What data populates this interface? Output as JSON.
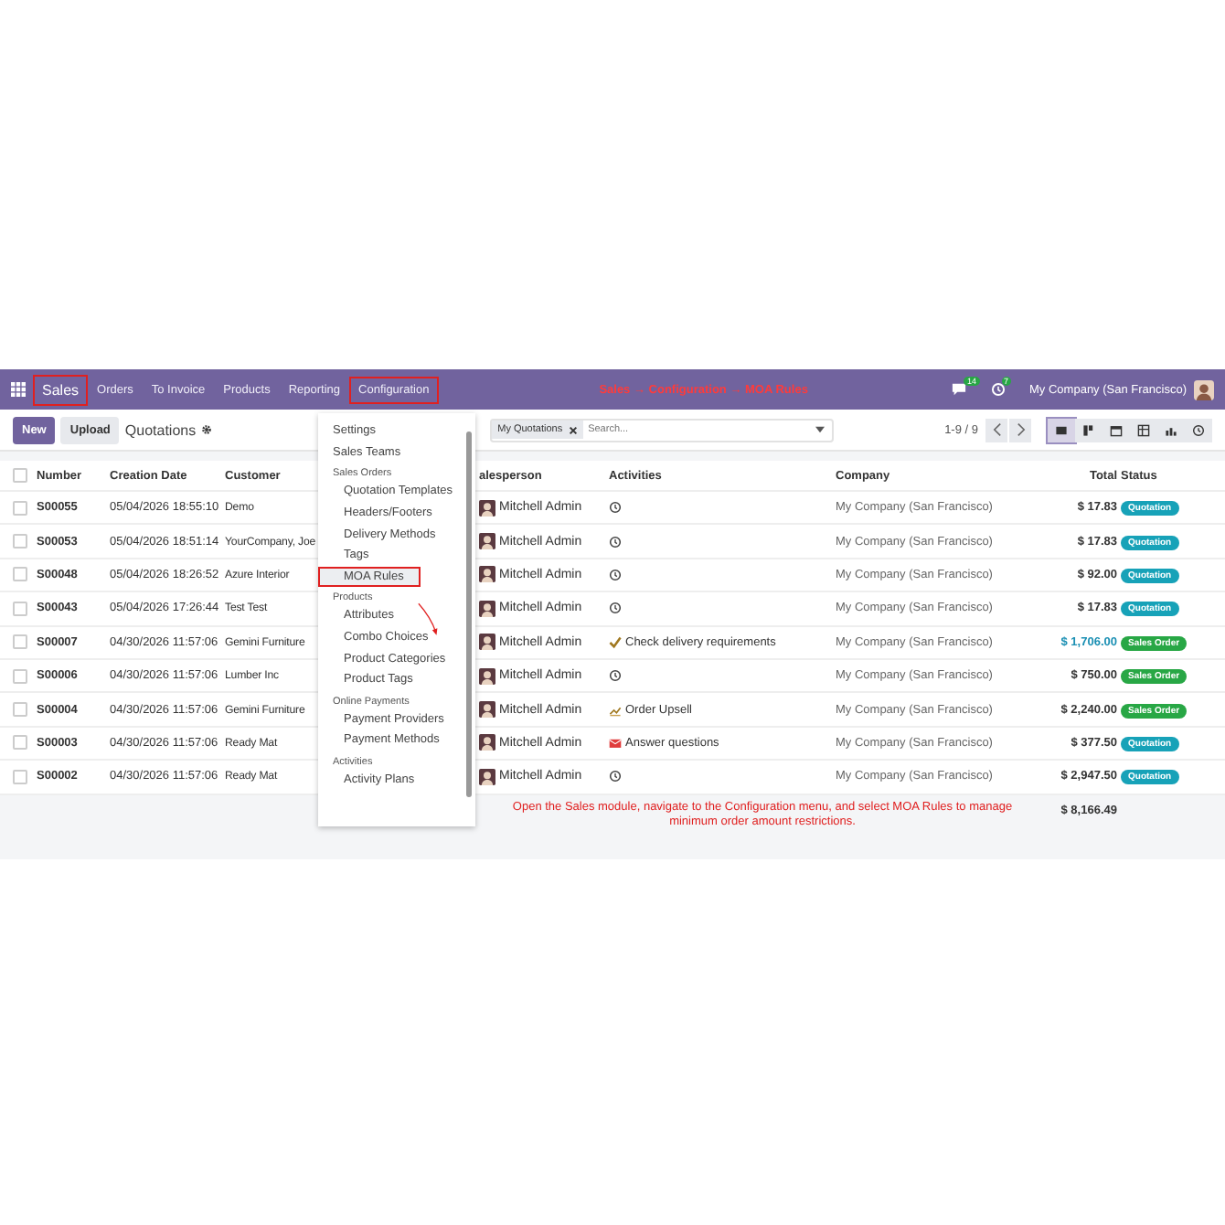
{
  "navbar": {
    "items": [
      {
        "label": "Sales",
        "highlighted": true,
        "kind": "brand"
      },
      {
        "label": "Orders",
        "highlighted": false,
        "kind": "menu"
      },
      {
        "label": "To Invoice",
        "highlighted": false,
        "kind": "menu"
      },
      {
        "label": "Products",
        "highlighted": false,
        "kind": "menu"
      },
      {
        "label": "Reporting",
        "highlighted": false,
        "kind": "menu"
      },
      {
        "label": "Configuration",
        "highlighted": true,
        "kind": "menu"
      }
    ],
    "caption": "Sales → Configuration → MOA Rules",
    "messages_badge": "14",
    "activities_badge": "7",
    "company": "My Company (San Francisco)"
  },
  "control_bar": {
    "new_button": "New",
    "upload_button": "Upload",
    "title": "Quotations",
    "search_facet": "My Quotations",
    "search_placeholder": "Search...",
    "pager": "1-9 / 9",
    "views": [
      {
        "kind": "list",
        "selected": true
      },
      {
        "kind": "kanban",
        "selected": false
      },
      {
        "kind": "calendar",
        "selected": false
      },
      {
        "kind": "pivot",
        "selected": false
      },
      {
        "kind": "graph",
        "selected": false
      },
      {
        "kind": "activity",
        "selected": false
      }
    ]
  },
  "table": {
    "select_all_checked": false,
    "columns": [
      "Number",
      "Creation Date",
      "Customer",
      "alesperson",
      "Activities",
      "Company",
      "Total",
      "Status"
    ],
    "rows": [
      {
        "checked": false,
        "number": "S00055",
        "date": "05/04/2026 18:55:10",
        "customer": "Demo",
        "salesperson": "Mitchell Admin",
        "activity": {
          "kind": "clock"
        },
        "company": "My Company (San Francisco)",
        "total": "$ 17.83",
        "total_highlight": false,
        "status": {
          "label": "Quotation",
          "color": "#17a2b8"
        }
      },
      {
        "checked": false,
        "number": "S00053",
        "date": "05/04/2026 18:51:14",
        "customer": "YourCompany, Joe",
        "salesperson": "Mitchell Admin",
        "activity": {
          "kind": "clock"
        },
        "company": "My Company (San Francisco)",
        "total": "$ 17.83",
        "total_highlight": false,
        "status": {
          "label": "Quotation",
          "color": "#17a2b8"
        }
      },
      {
        "checked": false,
        "number": "S00048",
        "date": "05/04/2026 18:26:52",
        "customer": "Azure Interior",
        "salesperson": "Mitchell Admin",
        "activity": {
          "kind": "clock"
        },
        "company": "My Company (San Francisco)",
        "total": "$ 92.00",
        "total_highlight": false,
        "status": {
          "label": "Quotation",
          "color": "#17a2b8"
        }
      },
      {
        "checked": false,
        "number": "S00043",
        "date": "05/04/2026 17:26:44",
        "customer": "Test Test",
        "salesperson": "Mitchell Admin",
        "activity": {
          "kind": "clock"
        },
        "company": "My Company (San Francisco)",
        "total": "$ 17.83",
        "total_highlight": false,
        "status": {
          "label": "Quotation",
          "color": "#17a2b8"
        }
      },
      {
        "checked": false,
        "number": "S00007",
        "date": "04/30/2026 11:57:06",
        "customer": "Gemini Furniture",
        "salesperson": "Mitchell Admin",
        "activity": {
          "kind": "check",
          "label": "Check delivery requirements"
        },
        "company": "My Company (San Francisco)",
        "total": "$ 1,706.00",
        "total_highlight": true,
        "status": {
          "label": "Sales Order",
          "color": "#28a745"
        }
      },
      {
        "checked": false,
        "number": "S00006",
        "date": "04/30/2026 11:57:06",
        "customer": "Lumber Inc",
        "salesperson": "Mitchell Admin",
        "activity": {
          "kind": "clock"
        },
        "company": "My Company (San Francisco)",
        "total": "$ 750.00",
        "total_highlight": false,
        "status": {
          "label": "Sales Order",
          "color": "#28a745"
        }
      },
      {
        "checked": false,
        "number": "S00004",
        "date": "04/30/2026 11:57:06",
        "customer": "Gemini Furniture",
        "salesperson": "Mitchell Admin",
        "activity": {
          "kind": "upsell",
          "label": "Order Upsell"
        },
        "company": "My Company (San Francisco)",
        "total": "$ 2,240.00",
        "total_highlight": false,
        "status": {
          "label": "Sales Order",
          "color": "#28a745"
        }
      },
      {
        "checked": false,
        "number": "S00003",
        "date": "04/30/2026 11:57:06",
        "customer": "Ready Mat",
        "salesperson": "Mitchell Admin",
        "activity": {
          "kind": "email",
          "label": "Answer questions"
        },
        "company": "My Company (San Francisco)",
        "total": "$ 377.50",
        "total_highlight": false,
        "status": {
          "label": "Quotation",
          "color": "#17a2b8"
        }
      },
      {
        "checked": false,
        "number": "S00002",
        "date": "04/30/2026 11:57:06",
        "customer": "Ready Mat",
        "salesperson": "Mitchell Admin",
        "activity": {
          "kind": "clock"
        },
        "company": "My Company (San Francisco)",
        "total": "$ 2,947.50",
        "total_highlight": false,
        "status": {
          "label": "Quotation",
          "color": "#17a2b8"
        }
      }
    ],
    "grand_total": "$ 8,166.49"
  },
  "dropdown": {
    "items": [
      {
        "label": "Settings",
        "selected": false
      },
      {
        "label": "Sales Teams",
        "selected": false
      },
      {
        "label": "Sales Orders",
        "children": [
          {
            "label": "Quotation Templates",
            "selected": false
          },
          {
            "label": "Headers/Footers",
            "selected": false
          },
          {
            "label": "Delivery Methods",
            "selected": false
          },
          {
            "label": "Tags",
            "selected": false
          },
          {
            "label": "MOA Rules",
            "selected": true,
            "highlighted": true
          }
        ]
      },
      {
        "label": "Products",
        "children": [
          {
            "label": "Attributes",
            "selected": false
          },
          {
            "label": "Combo Choices",
            "selected": false
          },
          {
            "label": "Product Categories",
            "selected": false
          },
          {
            "label": "Product Tags",
            "selected": false
          }
        ]
      },
      {
        "label": "Online Payments",
        "children": [
          {
            "label": "Payment Providers",
            "selected": false
          },
          {
            "label": "Payment Methods",
            "selected": false
          }
        ]
      },
      {
        "label": "Activities",
        "children": [
          {
            "label": "Activity Plans",
            "selected": false
          }
        ]
      }
    ]
  },
  "note": "Open the Sales module, navigate to the Configuration menu, and select MOA Rules to manage minimum order amount restrictions."
}
